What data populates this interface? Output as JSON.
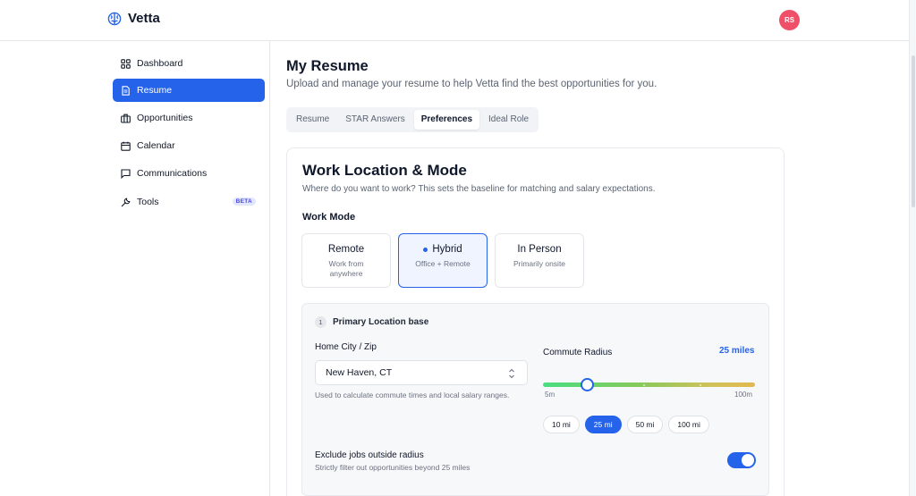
{
  "app": {
    "name": "Vetta",
    "user_initials": "RS"
  },
  "colors": {
    "accent": "#2563eb",
    "avatar": "#ef4f67",
    "beta_text": "#4f46e5"
  },
  "sidebar": {
    "items": [
      {
        "label": "Dashboard",
        "icon": "grid-icon",
        "active": false
      },
      {
        "label": "Resume",
        "icon": "document-icon",
        "active": true
      },
      {
        "label": "Opportunities",
        "icon": "briefcase-icon",
        "active": false
      },
      {
        "label": "Calendar",
        "icon": "calendar-icon",
        "active": false
      },
      {
        "label": "Communications",
        "icon": "chat-icon",
        "active": false
      },
      {
        "label": "Tools",
        "icon": "wrench-icon",
        "active": false,
        "badge": "BETA"
      }
    ]
  },
  "page": {
    "title": "My Resume",
    "subtitle": "Upload and manage your resume to help Vetta find the best opportunities for you."
  },
  "tabs": [
    {
      "label": "Resume",
      "active": false
    },
    {
      "label": "STAR Answers",
      "active": false
    },
    {
      "label": "Preferences",
      "active": true
    },
    {
      "label": "Ideal Role",
      "active": false
    }
  ],
  "work_location": {
    "title": "Work Location & Mode",
    "subtitle": "Where do you want to work? This sets the baseline for matching and salary expectations.",
    "work_mode_label": "Work Mode",
    "modes": [
      {
        "title": "Remote",
        "desc": "Work from anywhere",
        "selected": false
      },
      {
        "title": "Hybrid",
        "desc": "Office + Remote",
        "selected": true
      },
      {
        "title": "In Person",
        "desc": "Primarily onsite",
        "selected": false
      }
    ]
  },
  "primary_location": {
    "step": "1",
    "title": "Primary Location base",
    "city_label": "Home City / Zip",
    "city_value": "New Haven, CT",
    "city_hint": "Used to calculate commute times and local salary ranges.",
    "radius_label": "Commute Radius",
    "radius_value_text": "25 miles",
    "slider": {
      "min": 5,
      "max": 100,
      "value": 25,
      "min_label": "5m",
      "max_label": "100m"
    },
    "presets": [
      {
        "label": "10 mi",
        "active": false
      },
      {
        "label": "25 mi",
        "active": true
      },
      {
        "label": "50 mi",
        "active": false
      },
      {
        "label": "100 mi",
        "active": false
      }
    ],
    "exclude_title": "Exclude jobs outside radius",
    "exclude_sub": "Strictly filter out opportunities beyond 25 miles",
    "exclude_on": true
  }
}
